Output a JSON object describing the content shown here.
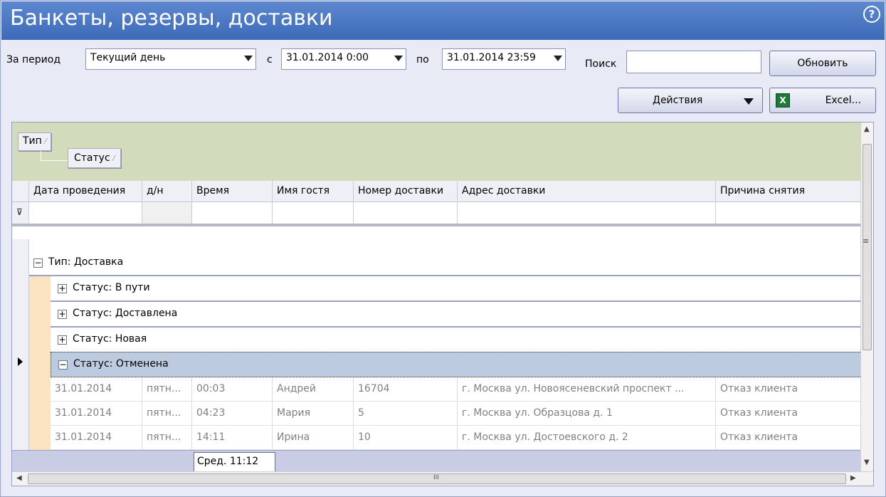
{
  "window": {
    "title": "Банкеты, резервы, доставки",
    "help_glyph": "?"
  },
  "filters": {
    "period_label": "За период",
    "period_value": "Текущий день",
    "from_label": "с",
    "from_value": "31.01.2014 0:00",
    "to_label": "по",
    "to_value": "31.01.2014 23:59",
    "search_label": "Поиск",
    "search_value": ""
  },
  "buttons": {
    "refresh": "Обновить",
    "actions": "Действия",
    "excel": "Excel..."
  },
  "grouping": {
    "chips": [
      "Тип",
      "Статус"
    ]
  },
  "columns": [
    "Дата проведения",
    "д/н",
    "Время",
    "Имя гостя",
    "Номер доставки",
    "Адрес доставки",
    "Причина снятия"
  ],
  "groups": {
    "type_group": "Тип: Доставка",
    "statuses": [
      "Статус: В пути",
      "Статус: Доставлена",
      "Статус: Новая",
      "Статус: Отменена"
    ]
  },
  "rows": [
    {
      "date": "31.01.2014",
      "day": "пятн...",
      "time": "00:03",
      "guest": "Андрей",
      "number": "16704",
      "address": "г. Москва ул. Новоясеневский проспект ...",
      "reason": "Отказ клиента"
    },
    {
      "date": "31.01.2014",
      "day": "пятн...",
      "time": "04:23",
      "guest": "Мария",
      "number": "5",
      "address": "г. Москва ул. Образцова д. 1",
      "reason": "Отказ клиента"
    },
    {
      "date": "31.01.2014",
      "day": "пятн...",
      "time": "14:11",
      "guest": "Ирина",
      "number": "10",
      "address": "г. Москва ул. Достоевского д. 2",
      "reason": "Отказ клиента"
    }
  ],
  "footer": {
    "avg_time": "Сред. 11:12"
  },
  "scrollbar": {
    "h_grip": "III",
    "v_grip": "≡"
  },
  "colors": {
    "titlebar": "#4a79c4",
    "group_panel": "#d2dcbc",
    "selected_row": "#bccbe0",
    "footer": "#c8cce4"
  }
}
